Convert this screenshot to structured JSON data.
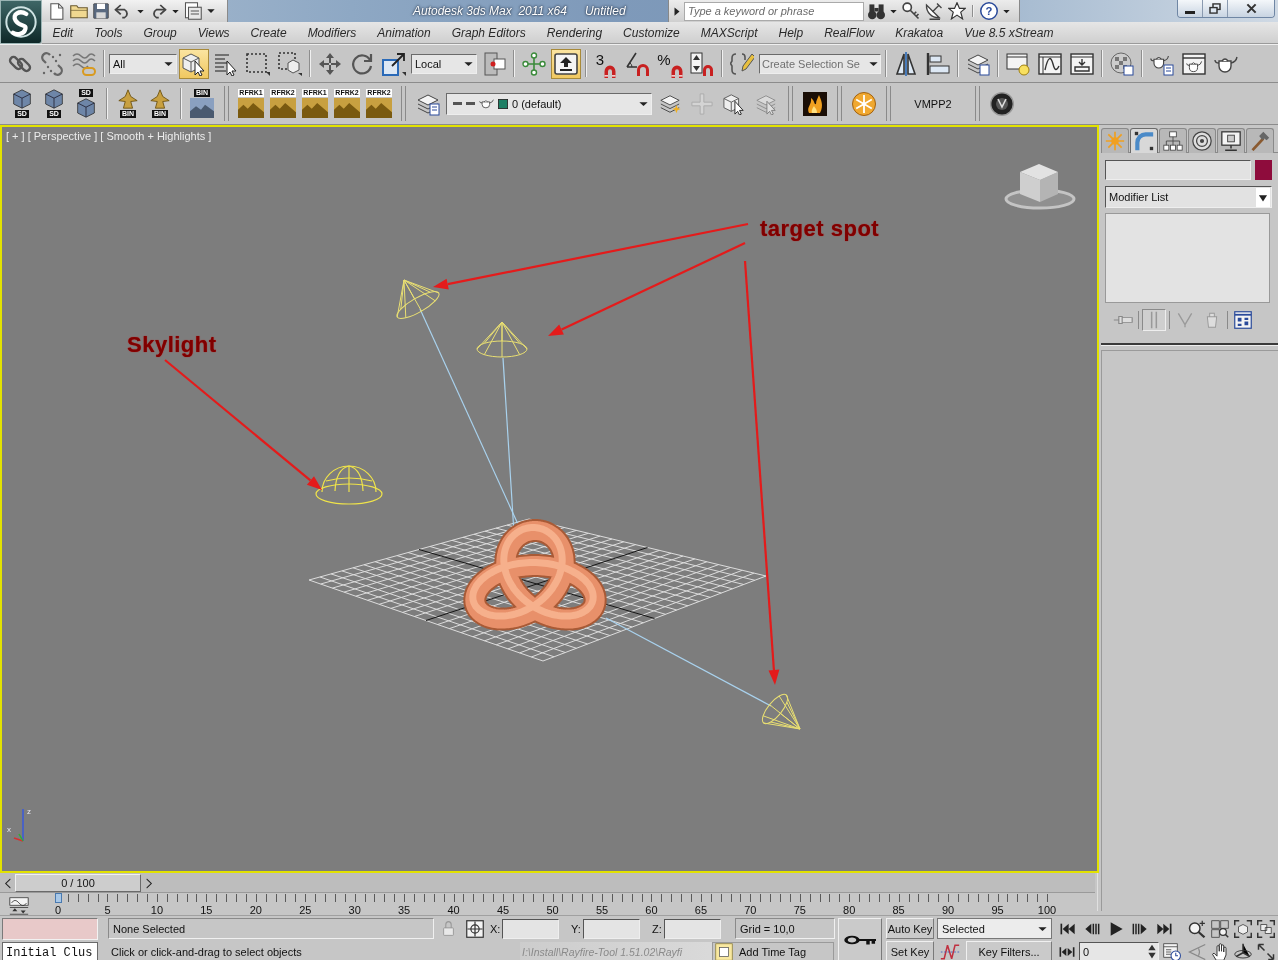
{
  "title_bar": {
    "app_title": "Autodesk 3ds Max  2011 x64",
    "document_title": "Untitled",
    "search": {
      "placeholder": "Type a keyword or phrase"
    },
    "help_glyph": "?"
  },
  "menu_bar": {
    "items": [
      "Edit",
      "Tools",
      "Group",
      "Views",
      "Create",
      "Modifiers",
      "Animation",
      "Graph Editors",
      "Rendering",
      "Customize",
      "MAXScript",
      "Help",
      "RealFlow",
      "Krakatoa",
      "Vue 8.5 xStream"
    ]
  },
  "main_toolbar": {
    "selection_filter": "All",
    "select_object": {
      "on": true
    },
    "reference_coordinate_system": "Local",
    "keyboard_shortcut_override": {
      "on": true
    },
    "snap_toggle": {
      "label": "3"
    },
    "percent_snap": {
      "label": "%"
    },
    "named_selection_set": {
      "placeholder": "Create Selection Se"
    }
  },
  "plugin_toolbar": {
    "plugin_buttons": [
      {
        "kind": "cube",
        "label": "SD"
      },
      {
        "kind": "cube",
        "label": "SD"
      },
      {
        "kind": "cubetop",
        "label": "SD"
      },
      {
        "kind": "tower",
        "label": "BIN"
      },
      {
        "kind": "tower",
        "label": "BIN"
      },
      {
        "kind": "terrain",
        "label": "BIN"
      }
    ],
    "rayfire_buttons": [
      {
        "label": "RFRK1"
      },
      {
        "label": "RFRK2"
      },
      {
        "label": "RFRK1"
      },
      {
        "label": "RFRK2"
      },
      {
        "label": "RFRK2"
      }
    ],
    "current_layer": "0 (default)",
    "layer_buttons": [
      {
        "disabled": false
      },
      {
        "disabled": true
      },
      {
        "disabled": false
      },
      {
        "disabled": true
      }
    ],
    "script_button": "VMPP2"
  },
  "viewport": {
    "labels": [
      "[ + ]",
      "[ Perspective ]",
      "[ Smooth + Highlights ]"
    ],
    "callouts": [
      {
        "text": "target spot"
      },
      {
        "text": "Skylight"
      }
    ],
    "axis_labels": [
      "z",
      "x"
    ]
  },
  "command_panel": {
    "tabs": [
      {
        "selected": false
      },
      {
        "selected": true
      },
      {
        "selected": false
      },
      {
        "selected": false
      },
      {
        "selected": false
      },
      {
        "selected": false
      }
    ],
    "modifier_list": "Modifier List",
    "show_end_result": {
      "on": true
    }
  },
  "time_slider": {
    "label": "0 / 100",
    "level": 0
  },
  "track_bar": {
    "frame_labels": [
      "0",
      "5",
      "10",
      "15",
      "20",
      "25",
      "30",
      "35",
      "40",
      "45",
      "50",
      "55",
      "60",
      "65",
      "70",
      "75",
      "80",
      "85",
      "90",
      "95",
      "100"
    ]
  },
  "status_bar": {
    "maxscript_input": "Initial Clus",
    "selection": "None Selected",
    "coordinates": [
      {
        "label": "X:"
      },
      {
        "label": "Y:"
      },
      {
        "label": "Z:"
      }
    ],
    "grid": "Grid = 10,0",
    "prompt": "Click or click-and-drag to select objects",
    "path_tooltip": "I:\\Install\\Rayfire-Tool 1.51.02\\Rayfi",
    "time_tag": "Add Time Tag"
  },
  "animation_controls": {
    "auto_key": {
      "label": "Auto Key",
      "on": false
    },
    "set_key": {
      "label": "Set Key",
      "on": false
    },
    "key_filter_set": "Selected",
    "key_filters": "Key Filters...",
    "current_frame": "0"
  }
}
